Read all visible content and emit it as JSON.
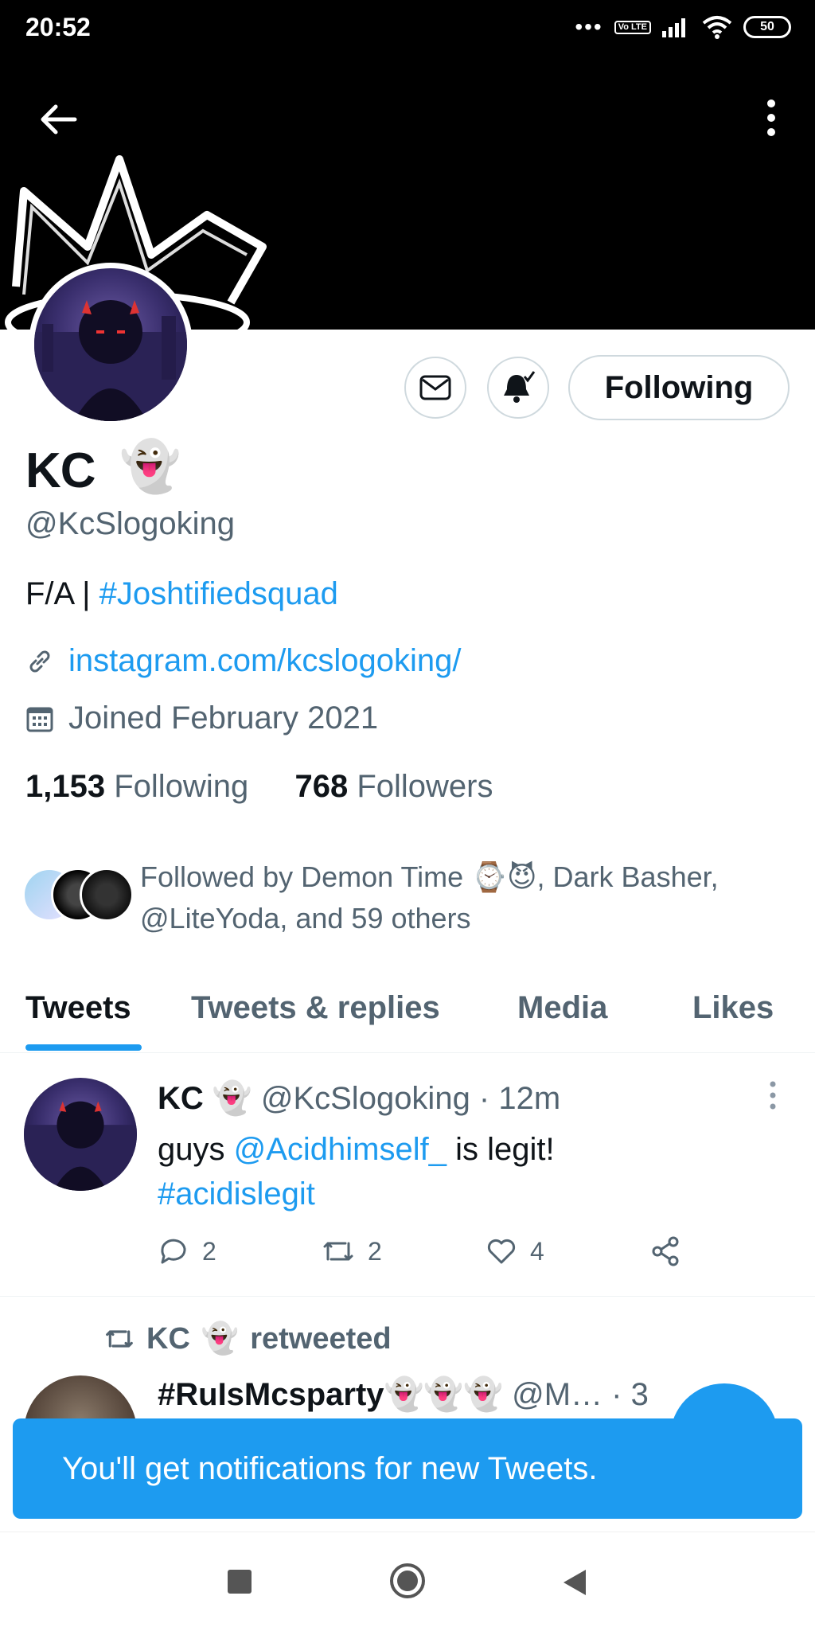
{
  "status_bar": {
    "time": "20:52",
    "dots": "•••",
    "volte": "Vo LTE",
    "battery": "50"
  },
  "profile": {
    "name": "KC",
    "name_emoji": "👻",
    "handle": "@KcSlogoking",
    "bio_text": "F/A  | ",
    "bio_hashtag": "#Joshtifiedsquad",
    "link": "instagram.com/kcslogoking/",
    "joined": "Joined February 2021",
    "following_count": "1,153",
    "following_label": "Following",
    "followers_count": "768",
    "followers_label": "Followers",
    "followed_by": "Followed by Demon Time ⌚😈, Dark Basher, @LiteYoda, and 59 others"
  },
  "buttons": {
    "following": "Following"
  },
  "tabs": [
    {
      "label": "Tweets"
    },
    {
      "label": "Tweets & replies"
    },
    {
      "label": "Media"
    },
    {
      "label": "Likes"
    }
  ],
  "tweet1": {
    "name": "KC",
    "emoji": "👻",
    "handle_time": "@KcSlogoking · 12m",
    "text_pre": "guys ",
    "mention": "@Acidhimself_",
    "text_post": "  is legit!",
    "hashtag": "#acidislegit",
    "replies": "2",
    "retweets": "2",
    "likes": "4"
  },
  "retweet_row": {
    "name": "KC",
    "emoji": "👻",
    "label": "retweeted"
  },
  "tweet2": {
    "name": "#RuIsMcsparty",
    "emojis": "👻👻👻",
    "handle_time": "@M… · 3"
  },
  "toast": {
    "message": "You'll get notifications for new Tweets."
  },
  "colors": {
    "accent": "#1d9bf0",
    "text": "#0f1419",
    "muted": "#536471"
  }
}
